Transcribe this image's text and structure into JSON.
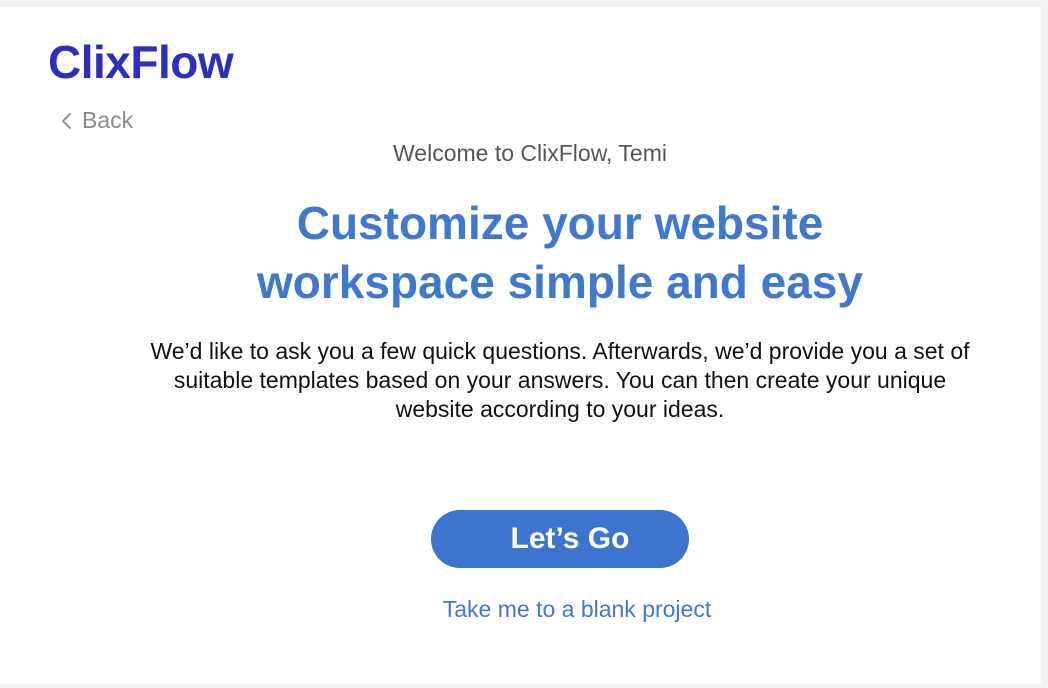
{
  "brand": {
    "name": "ClixFlow",
    "color": "#2b2fc0"
  },
  "nav": {
    "back_label": "Back",
    "back_icon": "chevron-left-icon"
  },
  "onboarding": {
    "welcome": "Welcome to ClixFlow, Temi",
    "headline_line1": "Customize your website",
    "headline_line2": "workspace simple and easy",
    "description": "We’d like to ask you a few quick questions. Afterwards, we’d provide you a set of suitable templates based on your answers. You can then create your unique website according to your ideas.",
    "cta_label": "Let’s Go",
    "blank_link_label": "Take me to a blank project"
  },
  "colors": {
    "accent": "#3e78cf",
    "button": "#3c74d0",
    "muted": "#8a8a8a"
  }
}
